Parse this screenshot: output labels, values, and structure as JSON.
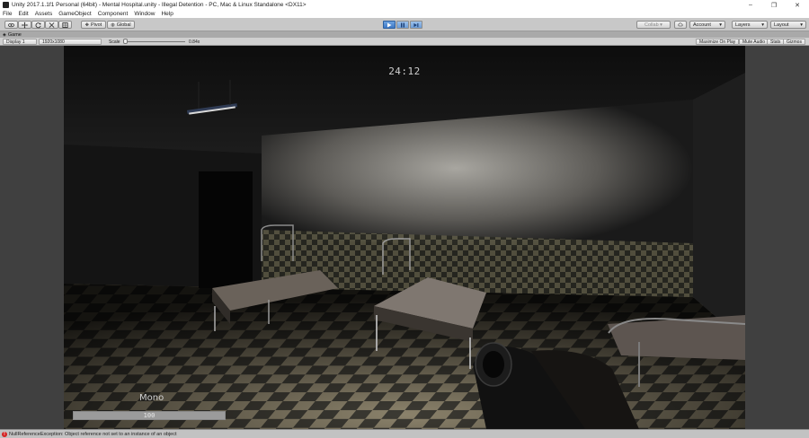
{
  "window": {
    "title": "Unity 2017.1.1f1 Personal (64bit) - Mental Hospital.unity - Illegal Detention - PC, Mac & Linux Standalone <DX11>",
    "minimize_glyph": "–",
    "maximize_glyph": "❐",
    "close_glyph": "✕"
  },
  "menu": {
    "items": [
      "File",
      "Edit",
      "Assets",
      "GameObject",
      "Component",
      "Window",
      "Help"
    ]
  },
  "toolbar": {
    "pivot_label": "Pivot",
    "global_label": "Global",
    "collab_label": "Collab ▾",
    "account_label": "Account",
    "layers_label": "Layers",
    "layout_label": "Layout",
    "dropdown_caret": "▾",
    "play_state": "playing"
  },
  "game_tab": {
    "label": "Game",
    "display": "Display 1",
    "resolution": "1920x1080",
    "scale_label": "Scale",
    "scale_value": "0.84x",
    "maximize_on_play": "Maximize On Play",
    "mute_audio": "Mute Audio",
    "stats": "Stats",
    "gizmos": "Gizmos"
  },
  "hud": {
    "timer": "24:12",
    "character_name": "Mono",
    "health_value": "100",
    "health_fraction": 1.0
  },
  "status": {
    "error_message": "NullReferenceException: Object reference not set to an instance of an object"
  },
  "colors": {
    "play_active": "#3d79c6",
    "error_red": "#d42020",
    "editor_bg": "#c2c2c2"
  }
}
